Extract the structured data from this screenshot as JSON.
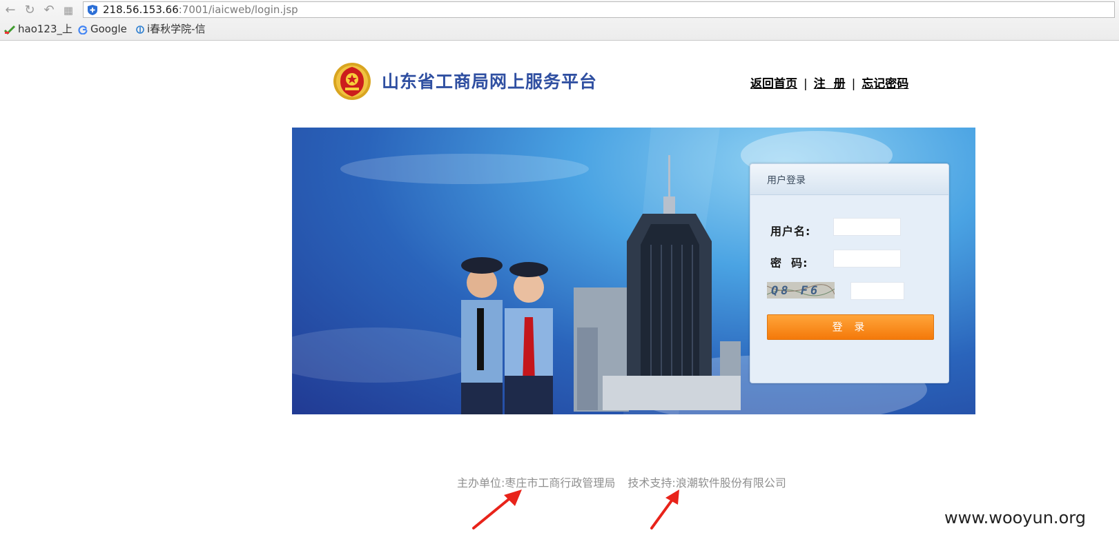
{
  "browser": {
    "url_host": "218.56.153.66",
    "url_path": ":7001/iaicweb/login.jsp",
    "bookmarks": [
      {
        "label": "hao123_上"
      },
      {
        "label": "Google"
      },
      {
        "label": "i春秋学院-信"
      }
    ]
  },
  "header": {
    "site_title": "山东省工商局网上服务平台",
    "links": {
      "home": "返回首页",
      "register": "注  册",
      "forgot": "忘记密码",
      "separator": "|"
    }
  },
  "login": {
    "panel_title": "用户登录",
    "username_label": "用户名:",
    "password_label": "密  码:",
    "captcha_text": "Q8 F6",
    "submit_label": "登 录",
    "username_value": "",
    "password_value": "",
    "captcha_value": ""
  },
  "footer": {
    "host_label": "主办单位:",
    "host_value": "枣庄市工商行政管理局",
    "support_label": "技术支持:",
    "support_value": "浪潮软件股份有限公司"
  },
  "watermark": "www.wooyun.org",
  "colors": {
    "title_blue": "#2f4fa1",
    "button_orange": "#f4790a",
    "annotation_red": "#e8231a"
  }
}
